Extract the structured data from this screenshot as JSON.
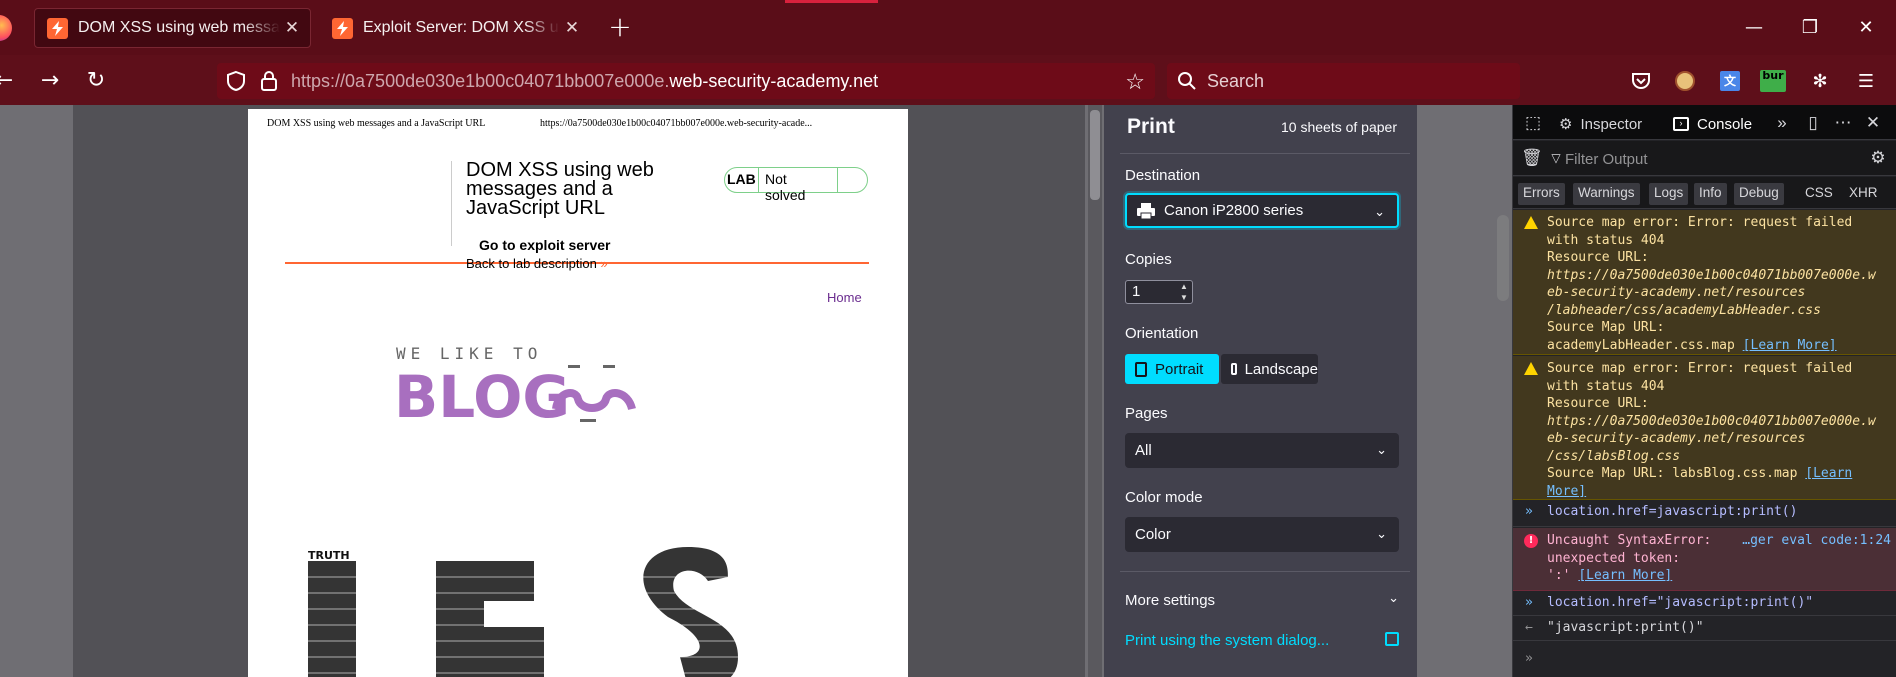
{
  "browser": {
    "tabs": [
      {
        "title": "DOM XSS using web messages and a JavaScript URL",
        "active": true
      },
      {
        "title": "Exploit Server: DOM XSS using web messages and a JavaScript URL",
        "active": false
      }
    ],
    "url_prefix": "https://0a7500de030e1b00c04071bb007e000e.",
    "url_domain": "web-security-academy.net",
    "search_placeholder": "Search",
    "extension_badge": "bur",
    "colors": {
      "chrome": "#5a0d18",
      "accent": "#00ddff"
    }
  },
  "print_preview": {
    "header_left": "DOM XSS using web messages and a JavaScript URL",
    "header_right": "https://0a7500de030e1b00c04071bb007e000e.web-security-acade...",
    "lab_title": "DOM XSS using web messages and a JavaScript URL",
    "lab_label": "LAB",
    "lab_status": "Not solved",
    "exploit_link": "Go to exploit server",
    "back_link": "Back to lab description",
    "home_link": "Home",
    "logo_small": "WE LIKE TO",
    "logo_big": "BLOG",
    "art_word": "TRUTH"
  },
  "print_settings": {
    "title": "Print",
    "sheets": "10 sheets of paper",
    "destination_label": "Destination",
    "destination_value": "Canon iP2800 series",
    "copies_label": "Copies",
    "copies_value": "1",
    "orientation_label": "Orientation",
    "portrait": "Portrait",
    "landscape": "Landscape",
    "pages_label": "Pages",
    "pages_value": "All",
    "color_label": "Color mode",
    "color_value": "Color",
    "more_settings": "More settings",
    "system_dialog": "Print using the system dialog..."
  },
  "devtools": {
    "tabs": [
      "Inspector",
      "Console"
    ],
    "filter_placeholder": "Filter Output",
    "chips": [
      "Errors",
      "Warnings",
      "Logs",
      "Info",
      "Debug",
      "CSS",
      "XHR"
    ],
    "warning1": {
      "l1": "Source map error: Error: request failed",
      "l2": "with status 404",
      "l3": "Resource URL:",
      "l4": "https://0a7500de030e1b00c04071bb007e000e.w",
      "l5": "eb-security-academy.net/resources",
      "l6": "/labheader/css/academyLabHeader.css",
      "l7": "Source Map URL:",
      "l8": "academyLabHeader.css.map",
      "link": "[Learn More]"
    },
    "warning2": {
      "l1": "Source map error: Error: request failed",
      "l2": "with status 404",
      "l3": "Resource URL:",
      "l4": "https://0a7500de030e1b00c04071bb007e000e.w",
      "l5": "eb-security-academy.net/resources",
      "l6": "/css/labsBlog.css",
      "l7": "Source Map URL: labsBlog.css.map",
      "link_a": "[Learn",
      "link_b": "More]"
    },
    "cmd1": "location.href=javascript:print()",
    "error": {
      "l1": "Uncaught SyntaxError:",
      "source": "…ger eval code:1:24",
      "l2": "unexpected token:",
      "l3": "':'",
      "link": "[Learn More]"
    },
    "cmd2": "location.href=\"javascript:print()\"",
    "result": "\"javascript:print()\""
  }
}
